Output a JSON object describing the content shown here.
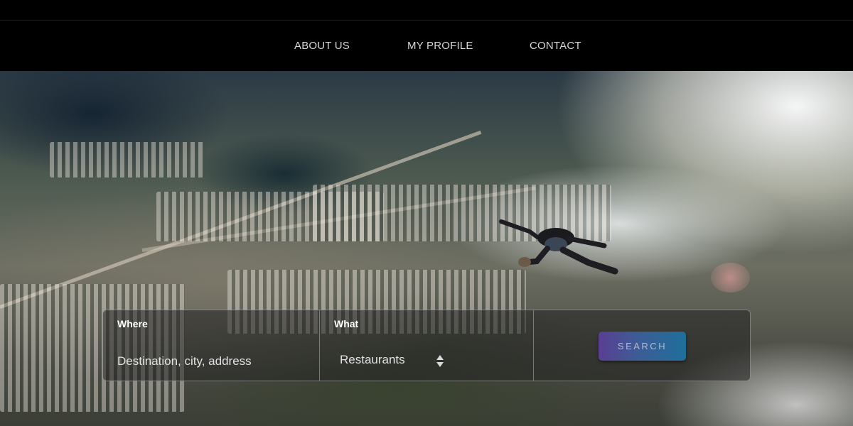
{
  "nav": {
    "about": "ABOUT US",
    "profile": "MY PROFILE",
    "contact": "CONTACT"
  },
  "search": {
    "where_label": "Where",
    "where_placeholder": "Destination, city, address",
    "what_label": "What",
    "what_selected": "Restaurants",
    "button_label": "SEARCH"
  },
  "colors": {
    "nav_background": "#000000",
    "button_gradient_start": "#5a3f92",
    "button_gradient_end": "#1f6f9a"
  },
  "icons": {
    "select_arrows": "updown-chevron-icon"
  }
}
